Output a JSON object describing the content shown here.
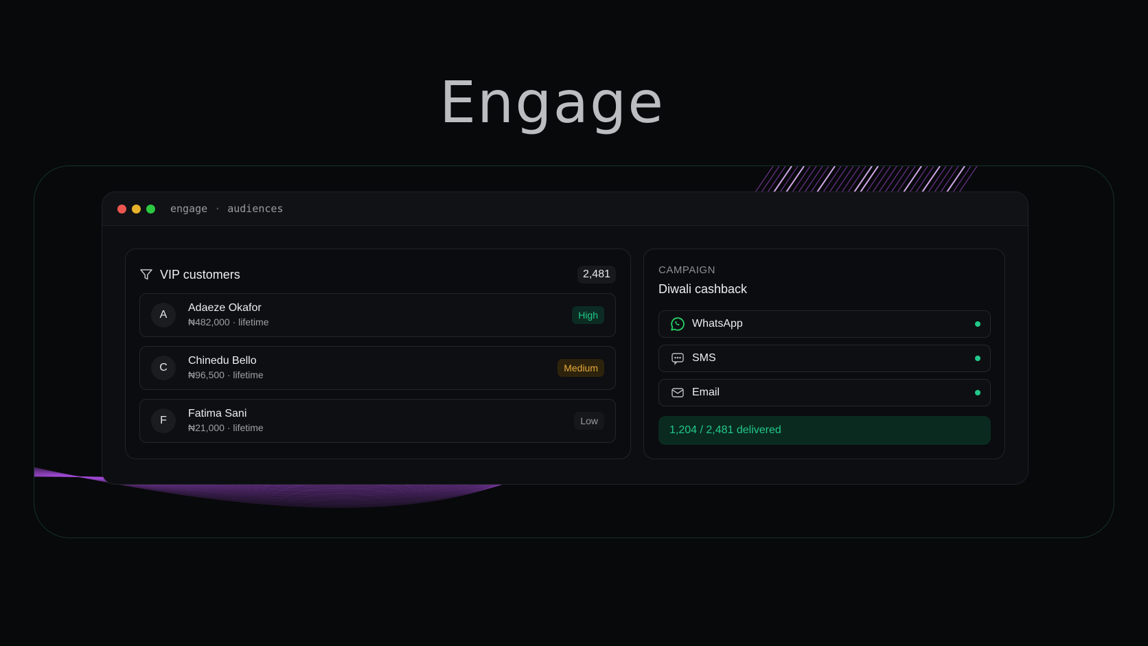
{
  "hero": {
    "title": "Engage"
  },
  "window": {
    "breadcrumb": [
      "engage",
      "audiences"
    ],
    "separator": "·"
  },
  "audience": {
    "title": "VIP customers",
    "count": "2,481",
    "customers": [
      {
        "initial": "A",
        "name": "Adaeze Okafor",
        "meta": "₦482,000 · lifetime",
        "tier": "High"
      },
      {
        "initial": "C",
        "name": "Chinedu Bello",
        "meta": "₦96,500 · lifetime",
        "tier": "Medium"
      },
      {
        "initial": "F",
        "name": "Fatima Sani",
        "meta": "₦21,000 · lifetime",
        "tier": "Low"
      }
    ]
  },
  "campaign": {
    "label": "CAMPAIGN",
    "title": "Diwali cashback",
    "channels": [
      {
        "name": "WhatsApp",
        "icon": "whatsapp-icon",
        "status": "active"
      },
      {
        "name": "SMS",
        "icon": "sms-icon",
        "status": "active"
      },
      {
        "name": "Email",
        "icon": "email-icon",
        "status": "active"
      }
    ],
    "delivered": "1,204 / 2,481 delivered"
  },
  "colors": {
    "accent_green": "#22c98a",
    "medium_amber": "#e6a93a",
    "deco_purple": "#a24cd6",
    "background": "#08090b"
  }
}
